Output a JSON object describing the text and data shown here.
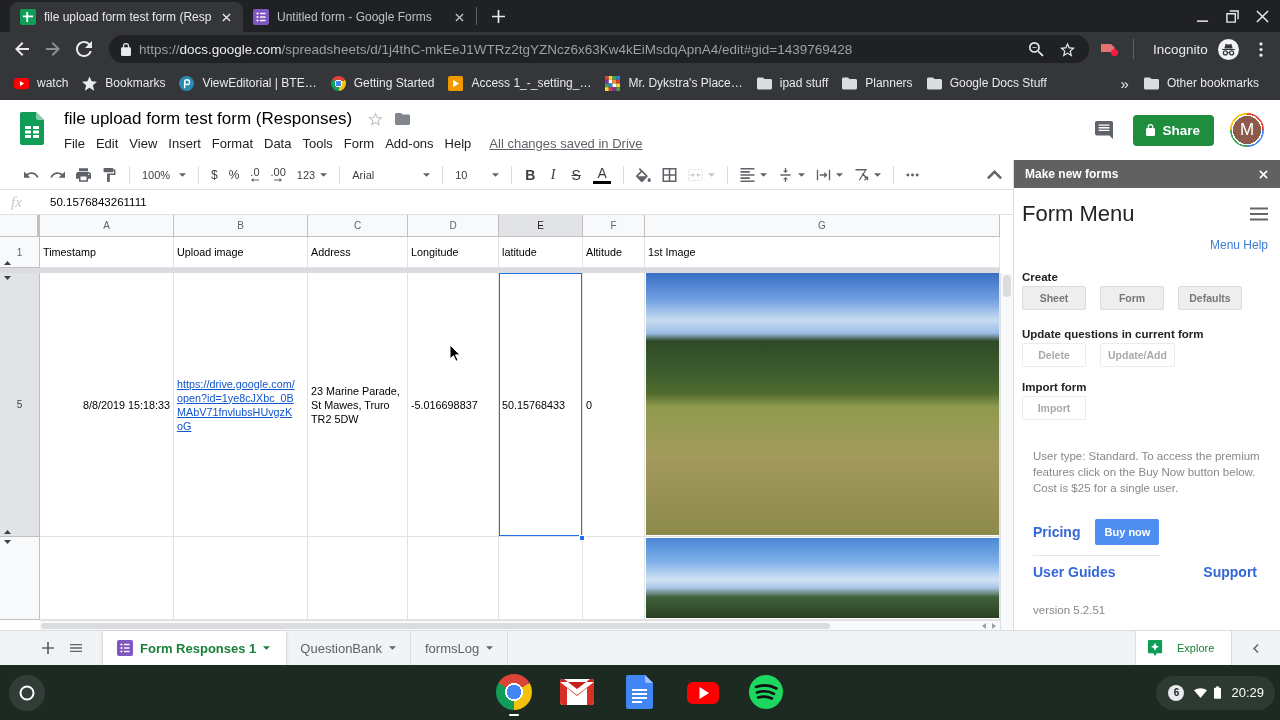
{
  "browser": {
    "tabs": [
      {
        "title": "file upload form test form (Resp",
        "kind": "spreadsheet",
        "selected": true
      },
      {
        "title": "Untitled form - Google Forms",
        "kind": "form",
        "selected": false
      }
    ],
    "address": {
      "scheme": "https://",
      "host": "docs.google.com",
      "path": "/spreadsheets/d/1j4thC-mkEeJ1WTRz2tgYZNcz6x63Kw4kEiMsdqApnA4/edit#gid=1439769428"
    },
    "profile": "Incognito",
    "bookmarks": [
      {
        "label": "watch",
        "kind": "video"
      },
      {
        "label": "Bookmarks",
        "kind": "star"
      },
      {
        "label": "ViewEditorial | BTE…",
        "kind": "badge"
      },
      {
        "label": "Getting Started",
        "kind": "browser"
      },
      {
        "label": "Access 1_-_setting_…",
        "kind": "presentation"
      },
      {
        "label": "Mr. Dykstra's Place…",
        "kind": "mosaic"
      },
      {
        "label": "ipad stuff",
        "kind": "folder"
      },
      {
        "label": "Planners",
        "kind": "folder"
      },
      {
        "label": "Google Docs Stuff",
        "kind": "folder"
      }
    ],
    "bookmarks_overflow": "»",
    "other_bookmarks": "Other bookmarks"
  },
  "sheets": {
    "title": "file upload form test form (Responses)",
    "menu": [
      "File",
      "Edit",
      "View",
      "Insert",
      "Format",
      "Data",
      "Tools",
      "Form",
      "Add-ons",
      "Help"
    ],
    "save_status": "All changes saved in Drive",
    "share": "Share",
    "avatar": "M",
    "toolbar": {
      "zoom": "100%",
      "currency": "$",
      "percent": "%",
      "decrease_decimals": ".0",
      "increase_decimals": ".00",
      "number_format": "123",
      "font": "Arial",
      "font_size": "10",
      "bold": "B",
      "italic": "I",
      "strikethrough": "S",
      "text_color": "A"
    },
    "formula_bar": {
      "label": "fx",
      "value": "50.1576843261111"
    },
    "columns": [
      {
        "letter": "A",
        "selected": false
      },
      {
        "letter": "B",
        "selected": false
      },
      {
        "letter": "C",
        "selected": false
      },
      {
        "letter": "D",
        "selected": false
      },
      {
        "letter": "E",
        "selected": true
      },
      {
        "letter": "F",
        "selected": false
      },
      {
        "letter": "G",
        "selected": false
      }
    ],
    "rows": [
      {
        "number": "1",
        "selected": false,
        "cells": [
          {
            "kind": "text",
            "text": "Timestamp",
            "selected": false
          },
          {
            "kind": "text",
            "text": "Upload image",
            "selected": false
          },
          {
            "kind": "text",
            "text": "Address",
            "selected": false
          },
          {
            "kind": "text",
            "text": "Longitude",
            "selected": false
          },
          {
            "kind": "text",
            "text": "latitude",
            "selected": false
          },
          {
            "kind": "text",
            "text": "Altitude",
            "selected": false
          },
          {
            "kind": "text",
            "text": "1st Image",
            "selected": false
          }
        ]
      },
      {
        "number": "5",
        "selected": true,
        "cells": [
          {
            "kind": "date",
            "text": "8/8/2019 15:18:33",
            "selected": false
          },
          {
            "kind": "link",
            "text": "https://drive.google.com/open?id=1ye8cJXbc_0BMAbV71fnvlubsHUvgzKoG",
            "selected": false
          },
          {
            "kind": "text",
            "text": "23 Marine Parade, St Mawes, Truro TR2 5DW",
            "selected": false
          },
          {
            "kind": "text",
            "text": "-5.016698837",
            "selected": false
          },
          {
            "kind": "text",
            "text": "50.15768433",
            "selected": true
          },
          {
            "kind": "text",
            "text": "0",
            "selected": false
          },
          {
            "kind": "image",
            "selected": false
          }
        ]
      },
      {
        "selected": false,
        "cells": [
          {
            "kind": "blank",
            "selected": false
          },
          {
            "kind": "blank",
            "selected": false
          },
          {
            "kind": "blank",
            "selected": false
          },
          {
            "kind": "blank",
            "selected": false
          },
          {
            "kind": "blank",
            "selected": false
          },
          {
            "kind": "blank",
            "selected": false
          },
          {
            "kind": "image",
            "selected": false
          }
        ]
      }
    ],
    "sheet_tabs": [
      {
        "label": "Form Responses 1",
        "linked": true,
        "selected": true
      },
      {
        "label": "QuestionBank",
        "linked": false,
        "selected": false
      },
      {
        "label": "formsLog",
        "linked": false,
        "selected": false
      }
    ],
    "explore": "Explore"
  },
  "sidebar": {
    "title": "Make new forms",
    "heading": "Form Menu",
    "help_link": "Menu Help",
    "sections": [
      {
        "title": "Create",
        "buttons": [
          {
            "label": "Sheet",
            "disabled": false
          },
          {
            "label": "Form",
            "disabled": false
          },
          {
            "label": "Defaults",
            "disabled": false
          }
        ]
      },
      {
        "title": "Update questions in current form",
        "buttons": [
          {
            "label": "Delete",
            "disabled": true
          },
          {
            "label": "Update/Add",
            "disabled": true
          }
        ]
      },
      {
        "title": "Import form",
        "buttons": [
          {
            "label": "Import",
            "disabled": true
          }
        ]
      }
    ],
    "notice": "User type: Standard. To access the premium features click on the Buy Now button below. Cost is $25 for a single user.",
    "pricing": "Pricing",
    "buy": "Buy now",
    "guides": "User Guides",
    "support": "Support",
    "version": "version 5.2.51"
  },
  "shelf": {
    "notifications": "6",
    "time": "20:29"
  }
}
